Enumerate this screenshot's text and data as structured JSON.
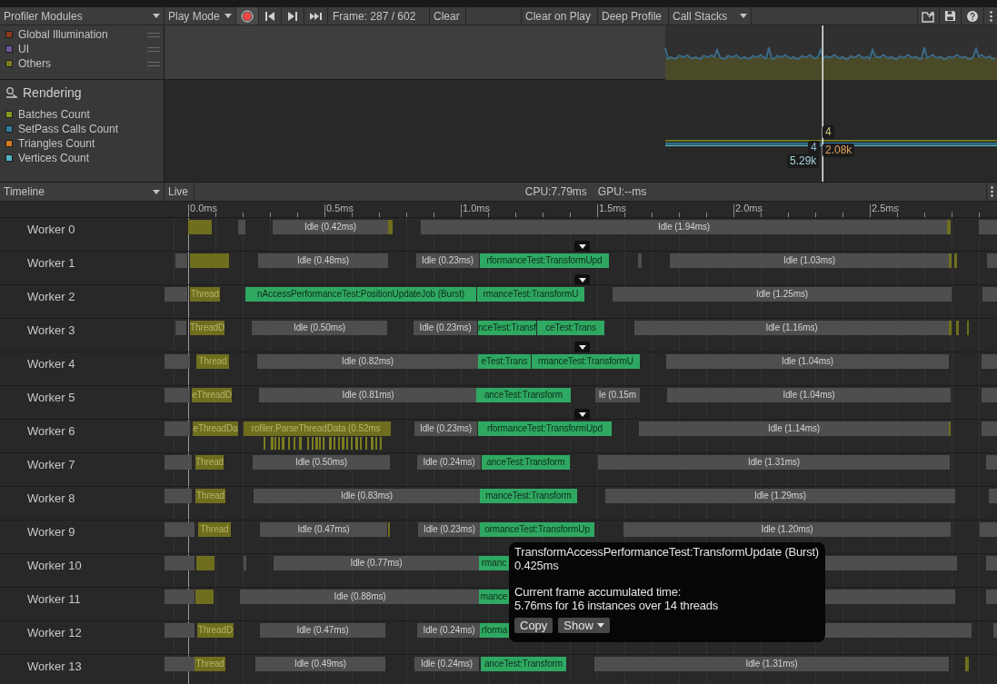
{
  "toolbar": {
    "modules_dropdown": "Profiler Modules",
    "mode_dropdown": "Play Mode",
    "recording": true,
    "frame": "Frame: 287 / 602",
    "clear": "Clear",
    "clear_on_play": "Clear on Play",
    "deep_profile": "Deep Profile",
    "call_stacks": "Call Stacks"
  },
  "cpu_module": {
    "legend": [
      {
        "name": "Global Illumination",
        "color": "#8b3a1e"
      },
      {
        "name": "UI",
        "color": "#6e55a0"
      },
      {
        "name": "Others",
        "color": "#7d7d1e"
      }
    ]
  },
  "rendering_module": {
    "title": "Rendering",
    "legend": [
      {
        "name": "Batches Count",
        "color": "#7f9a1c"
      },
      {
        "name": "SetPass Calls Count",
        "color": "#2f7ea0"
      },
      {
        "name": "Triangles Count",
        "color": "#d47a1c"
      },
      {
        "name": "Vertices Count",
        "color": "#4fb3c8"
      }
    ],
    "readouts": [
      {
        "text": "4",
        "color": "#c9c77a"
      },
      {
        "text": "4",
        "color": "#8fb7d0"
      },
      {
        "text": "2.08k",
        "color": "#e0a060"
      },
      {
        "text": "5.29k",
        "color": "#a8d4e0"
      }
    ]
  },
  "timeline": {
    "view_dropdown": "Timeline",
    "live": "Live",
    "cpu": "CPU:7.79ms",
    "gpu": "GPU:--ms",
    "ruler": [
      "0.0ms",
      "0.5ms",
      "1.0ms",
      "1.5ms",
      "2.0ms",
      "2.5ms"
    ],
    "rows": [
      {
        "name": "Worker 0",
        "expandable": true,
        "sub_samples": false,
        "blocks": [
          {
            "kind": "thread"
          },
          {
            "kind": "idle"
          },
          {
            "kind": "idle",
            "label": "Idle (0.42ms)"
          },
          {
            "kind": "thread"
          },
          {
            "kind": "idle",
            "label": "Idle (1.94ms)"
          },
          {
            "kind": "thread"
          },
          {
            "kind": "idle"
          }
        ]
      },
      {
        "name": "Worker 1",
        "expandable": true,
        "sub_samples": false,
        "blocks": [
          {
            "kind": "idle"
          },
          {
            "kind": "thread"
          },
          {
            "kind": "idle",
            "label": "Idle (0.48ms)"
          },
          {
            "kind": "idle",
            "label": "Idle (0.23ms)"
          },
          {
            "kind": "job",
            "label": "rformanceTest:TransformUpd"
          },
          {
            "kind": "idle"
          },
          {
            "kind": "idle",
            "label": "Idle (1.03ms)"
          },
          {
            "kind": "thread"
          },
          {
            "kind": "thread"
          },
          {
            "kind": "idle"
          }
        ]
      },
      {
        "name": "Worker 2",
        "expandable": false,
        "sub_samples": false,
        "blocks": [
          {
            "kind": "idle"
          },
          {
            "kind": "thread",
            "label": "Thread"
          },
          {
            "kind": "job",
            "label": "nAccessPerformanceTest:PositionUpdateJob (Burst)"
          },
          {
            "kind": "job",
            "label": "rmanceTest:TransformU"
          },
          {
            "kind": "idle",
            "label": "Idle (1.25ms)"
          },
          {
            "kind": "idle"
          }
        ]
      },
      {
        "name": "Worker 3",
        "expandable": true,
        "sub_samples": false,
        "blocks": [
          {
            "kind": "idle"
          },
          {
            "kind": "thread",
            "label": "ThreadD"
          },
          {
            "kind": "idle",
            "label": "Idle (0.50ms)"
          },
          {
            "kind": "idle",
            "label": "Idle (0.23ms)"
          },
          {
            "kind": "job",
            "label": "nceTest:Transf"
          },
          {
            "kind": "job",
            "label": "ceTest:Trans"
          },
          {
            "kind": "idle",
            "label": "Idle (1.16ms)"
          },
          {
            "kind": "thread"
          },
          {
            "kind": "thread"
          },
          {
            "kind": "thread"
          }
        ]
      },
      {
        "name": "Worker 4",
        "expandable": false,
        "sub_samples": false,
        "blocks": [
          {
            "kind": "idle"
          },
          {
            "kind": "thread",
            "label": "Thread"
          },
          {
            "kind": "idle",
            "label": "Idle (0.82ms)"
          },
          {
            "kind": "job",
            "label": "eTest:Trans"
          },
          {
            "kind": "job",
            "label": "rmanceTest:TransformU"
          },
          {
            "kind": "idle",
            "label": "Idle (1.04ms)"
          },
          {
            "kind": "idle"
          }
        ]
      },
      {
        "name": "Worker 5",
        "expandable": true,
        "sub_samples": false,
        "blocks": [
          {
            "kind": "idle"
          },
          {
            "kind": "thread",
            "label": "eThreadD"
          },
          {
            "kind": "idle",
            "label": "Idle (0.81ms)"
          },
          {
            "kind": "job",
            "label": "anceTest:Transform"
          },
          {
            "kind": "idle",
            "label": "le (0.15m"
          },
          {
            "kind": "idle",
            "label": "Idle (1.04ms)"
          },
          {
            "kind": "idle"
          }
        ]
      },
      {
        "name": "Worker 6",
        "expandable": false,
        "sub_samples": true,
        "blocks": [
          {
            "kind": "idle"
          },
          {
            "kind": "thread",
            "label": "eThreadDa"
          },
          {
            "kind": "thread",
            "label": "rofiler.ParseThreadData (0.52ms"
          },
          {
            "kind": "thread"
          },
          {
            "kind": "idle",
            "label": "Idle (0.23ms)"
          },
          {
            "kind": "job",
            "label": "rformanceTest:TransformUpd"
          },
          {
            "kind": "idle",
            "label": "Idle (1.14ms)"
          },
          {
            "kind": "thread"
          },
          {
            "kind": "idle"
          }
        ]
      },
      {
        "name": "Worker 7",
        "expandable": false,
        "sub_samples": false,
        "blocks": [
          {
            "kind": "idle"
          },
          {
            "kind": "thread",
            "label": "Thread"
          },
          {
            "kind": "idle",
            "label": "Idle (0.50ms)"
          },
          {
            "kind": "idle",
            "label": "Idle (0.24ms)"
          },
          {
            "kind": "job",
            "label": "anceTest:Transform"
          },
          {
            "kind": "idle",
            "label": "Idle (1.31ms)"
          },
          {
            "kind": "idle"
          }
        ]
      },
      {
        "name": "Worker 8",
        "expandable": false,
        "sub_samples": false,
        "blocks": [
          {
            "kind": "idle"
          },
          {
            "kind": "thread",
            "label": "Thread"
          },
          {
            "kind": "idle",
            "label": "Idle (0.83ms)"
          },
          {
            "kind": "job",
            "label": "manceTest:Transform"
          },
          {
            "kind": "idle",
            "label": "Idle (1.29ms)"
          },
          {
            "kind": "idle"
          }
        ]
      },
      {
        "name": "Worker 9",
        "sub_samples": false,
        "blocks": [
          {
            "kind": "idle"
          },
          {
            "kind": "thread",
            "label": "Thread"
          },
          {
            "kind": "idle",
            "label": "Idle (0.47ms)"
          },
          {
            "kind": "thread"
          },
          {
            "kind": "idle",
            "label": "Idle (0.23ms)"
          },
          {
            "kind": "job",
            "label": "ormanceTest:TransformUp"
          },
          {
            "kind": "idle",
            "label": "Idle (1.20ms)"
          },
          {
            "kind": "idle"
          }
        ]
      },
      {
        "name": "Worker 10",
        "sub_samples": false,
        "blocks": [
          {
            "kind": "idle"
          },
          {
            "kind": "thread"
          },
          {
            "kind": "idle"
          },
          {
            "kind": "idle",
            "label": "Idle (0.77ms)"
          },
          {
            "kind": "job",
            "label": "rmanc"
          },
          {
            "kind": "idle"
          },
          {
            "kind": "idle"
          }
        ]
      },
      {
        "name": "Worker 11",
        "sub_samples": false,
        "blocks": [
          {
            "kind": "idle"
          },
          {
            "kind": "thread"
          },
          {
            "kind": "idle",
            "label": "Idle (0.88ms)"
          },
          {
            "kind": "job",
            "label": "mance"
          },
          {
            "kind": "idle"
          },
          {
            "kind": "idle"
          }
        ]
      },
      {
        "name": "Worker 12",
        "expandable": false,
        "sub_samples": false,
        "blocks": [
          {
            "kind": "idle"
          },
          {
            "kind": "thread",
            "label": "ThreadD"
          },
          {
            "kind": "idle",
            "label": "Idle (0.47ms)"
          },
          {
            "kind": "idle",
            "label": "Idle (0.24ms)"
          },
          {
            "kind": "job",
            "label": "rforma"
          },
          {
            "kind": "idle"
          },
          {
            "kind": "idle"
          }
        ]
      },
      {
        "name": "Worker 13",
        "expandable": false,
        "sub_samples": false,
        "blocks": [
          {
            "kind": "idle"
          },
          {
            "kind": "thread",
            "label": "Thread"
          },
          {
            "kind": "idle",
            "label": "Idle (0.49ms)"
          },
          {
            "kind": "idle",
            "label": "Idle (0.24ms)"
          },
          {
            "kind": "job",
            "label": "anceTest:Transform"
          },
          {
            "kind": "idle",
            "label": "Idle (1.31ms)"
          },
          {
            "kind": "thread"
          }
        ]
      }
    ]
  },
  "tooltip": {
    "title": "TransformAccessPerformanceTest:TransformUpdate (Burst)",
    "duration": "0.425ms",
    "accumulated_label": "Current frame accumulated time:",
    "accumulated": "5.76ms for 16 instances over 14 threads",
    "buttons": [
      "Copy",
      "Show"
    ]
  }
}
